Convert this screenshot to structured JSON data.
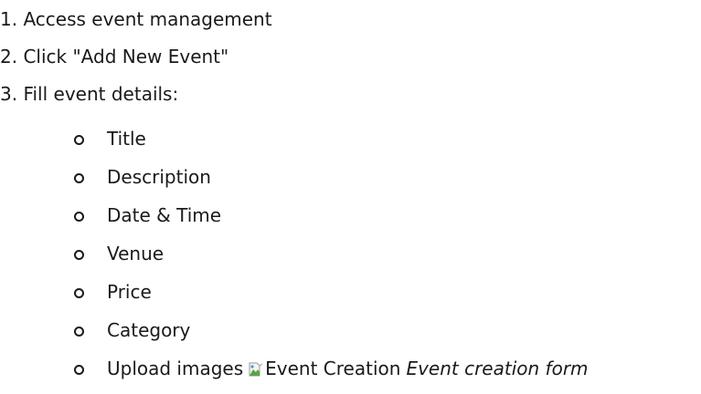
{
  "steps": [
    {
      "number": "1.",
      "text": "Access event management"
    },
    {
      "number": "2.",
      "text": "Click \"Add New Event\""
    },
    {
      "number": "3.",
      "text": "Fill event details:"
    }
  ],
  "details": [
    "Title",
    "Description",
    "Date & Time",
    "Venue",
    "Price",
    "Category"
  ],
  "upload": {
    "text": "Upload images",
    "image_alt": "Event Creation",
    "caption": "Event creation form"
  }
}
